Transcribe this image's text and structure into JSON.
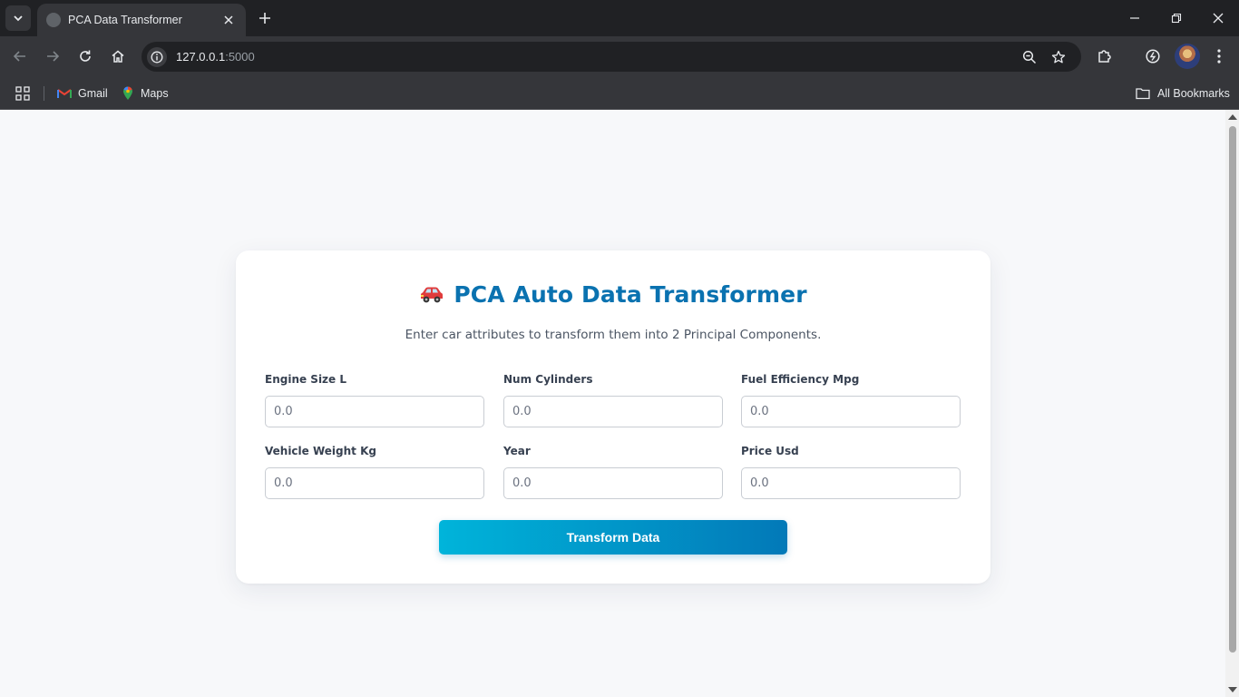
{
  "browser": {
    "tab_title": "PCA Data Transformer",
    "url_host": "127.0.0.1",
    "url_port": ":5000",
    "bookmarks": [
      {
        "label": "Gmail"
      },
      {
        "label": "Maps"
      }
    ],
    "all_bookmarks_label": "All Bookmarks"
  },
  "page": {
    "title": "PCA Auto Data Transformer",
    "subtitle": "Enter car attributes to transform them into 2 Principal Components.",
    "fields": [
      {
        "label": "Engine Size L",
        "placeholder": "0.0"
      },
      {
        "label": "Num Cylinders",
        "placeholder": "0.0"
      },
      {
        "label": "Fuel Efficiency Mpg",
        "placeholder": "0.0"
      },
      {
        "label": "Vehicle Weight Kg",
        "placeholder": "0.0"
      },
      {
        "label": "Year",
        "placeholder": "0.0"
      },
      {
        "label": "Price Usd",
        "placeholder": "0.0"
      }
    ],
    "submit_label": "Transform Data"
  },
  "colors": {
    "title": "#0a72b0",
    "button_gradient_start": "#00b4da",
    "button_gradient_end": "#0279b8",
    "page_background": "#f7f8fa",
    "chrome_dark": "#202124",
    "chrome_toolbar": "#35363a"
  },
  "icons": {
    "title_icon": "red-car-icon"
  }
}
